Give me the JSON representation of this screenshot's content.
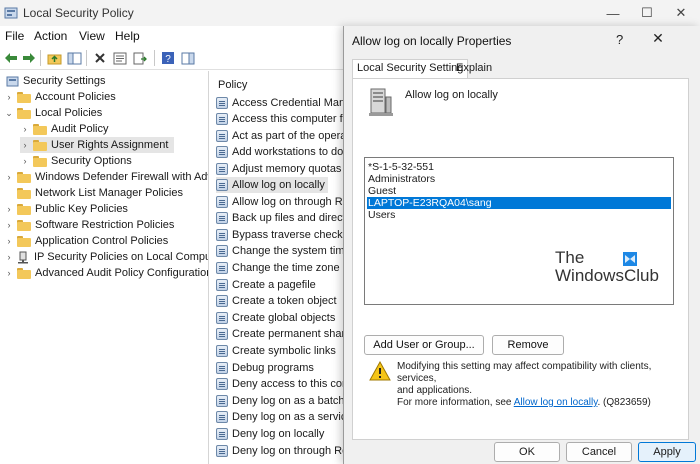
{
  "window": {
    "title": "Local Security Policy",
    "minimize": "—",
    "maximize": "☐",
    "close": "✕"
  },
  "menu": [
    "File",
    "Action",
    "View",
    "Help"
  ],
  "tree": [
    {
      "label": "Security Settings",
      "indent": 0,
      "chevron": "",
      "icon": "security"
    },
    {
      "label": "Account Policies",
      "indent": 1,
      "chevron": "›",
      "icon": "folder"
    },
    {
      "label": "Local Policies",
      "indent": 1,
      "chevron": "⌄",
      "icon": "folder"
    },
    {
      "label": "Audit Policy",
      "indent": 2,
      "chevron": "›",
      "icon": "folder"
    },
    {
      "label": "User Rights Assignment",
      "indent": 2,
      "chevron": "›",
      "icon": "folder",
      "selected": true
    },
    {
      "label": "Security Options",
      "indent": 2,
      "chevron": "›",
      "icon": "folder"
    },
    {
      "label": "Windows Defender Firewall with Adva",
      "indent": 1,
      "chevron": "›",
      "icon": "folder"
    },
    {
      "label": "Network List Manager Policies",
      "indent": 1,
      "chevron": "",
      "icon": "folder"
    },
    {
      "label": "Public Key Policies",
      "indent": 1,
      "chevron": "›",
      "icon": "folder"
    },
    {
      "label": "Software Restriction Policies",
      "indent": 1,
      "chevron": "›",
      "icon": "folder"
    },
    {
      "label": "Application Control Policies",
      "indent": 1,
      "chevron": "›",
      "icon": "folder"
    },
    {
      "label": "IP Security Policies on Local Compute",
      "indent": 1,
      "chevron": "›",
      "icon": "ipsec"
    },
    {
      "label": "Advanced Audit Policy Configuration",
      "indent": 1,
      "chevron": "›",
      "icon": "folder"
    }
  ],
  "policy_header": "Policy",
  "policies": [
    {
      "label": "Access Credential Mana"
    },
    {
      "label": "Access this computer fro"
    },
    {
      "label": "Act as part of the operat"
    },
    {
      "label": "Add workstations to dor"
    },
    {
      "label": "Adjust memory quotas f"
    },
    {
      "label": "Allow log on locally",
      "selected": true
    },
    {
      "label": "Allow log on through Re"
    },
    {
      "label": "Back up files and directo"
    },
    {
      "label": "Bypass traverse checkin"
    },
    {
      "label": "Change the system time"
    },
    {
      "label": "Change the time zone"
    },
    {
      "label": "Create a pagefile"
    },
    {
      "label": "Create a token object"
    },
    {
      "label": "Create global objects"
    },
    {
      "label": "Create permanent share"
    },
    {
      "label": "Create symbolic links"
    },
    {
      "label": "Debug programs"
    },
    {
      "label": "Deny access to this com"
    },
    {
      "label": "Deny log on as a batch j"
    },
    {
      "label": "Deny log on as a service"
    },
    {
      "label": "Deny log on locally"
    },
    {
      "label": "Deny log on through Re"
    }
  ],
  "dialog": {
    "title": "Allow log on locally Properties",
    "help": "?",
    "close": "✕",
    "tabs": [
      "Local Security Setting",
      "Explain"
    ],
    "policy_name": "Allow log on locally",
    "members": [
      {
        "label": "*S-1-5-32-551"
      },
      {
        "label": "Administrators"
      },
      {
        "label": "Guest"
      },
      {
        "label": "LAPTOP-E23RQA04\\sang",
        "selected": true
      },
      {
        "label": "Users"
      }
    ],
    "brand_line1": "The",
    "brand_line2": "WindowsClub",
    "add_button": "Add User or Group...",
    "remove_button": "Remove",
    "warning_line1": "Modifying this setting may affect compatibility with clients, services,",
    "warning_line2": "and applications.",
    "more_info_prefix": "For more information, see ",
    "more_info_link": "Allow log on locally",
    "more_info_suffix": ". (Q823659)",
    "ok": "OK",
    "cancel": "Cancel",
    "apply": "Apply"
  },
  "colors": {
    "selection": "#0078d7",
    "link": "#0066cc",
    "folder": "#f3c85a"
  }
}
